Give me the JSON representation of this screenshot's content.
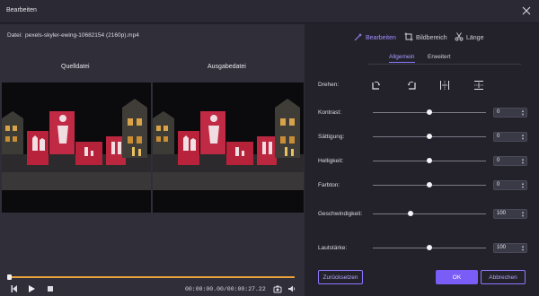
{
  "window": {
    "title": "Bearbeiten"
  },
  "file": {
    "label": "Datei:",
    "name": "pexels-skyler-ewing-10682154 (2160p).mp4"
  },
  "panes": {
    "source_label": "Quelldatei",
    "output_label": "Ausgabedatei"
  },
  "playback": {
    "timecode": "00:00:00.00/00:00:27.22",
    "progress_fraction": 1.0
  },
  "tabs": [
    {
      "label": "Bearbeiten",
      "icon": "magic-wand-icon",
      "active": true
    },
    {
      "label": "Bildbereich",
      "icon": "crop-icon",
      "active": false
    },
    {
      "label": "Länge",
      "icon": "scissors-icon",
      "active": false
    }
  ],
  "subtabs": [
    {
      "label": "Allgemein",
      "active": true
    },
    {
      "label": "Erweitert",
      "active": false
    }
  ],
  "rotate": {
    "label": "Drehen:",
    "buttons": [
      "rotate-right-icon",
      "rotate-left-icon",
      "flip-horizontal-icon",
      "flip-vertical-icon"
    ]
  },
  "adjustments": [
    {
      "label": "Kontrast:",
      "value": "0",
      "slider_fraction": 0.5
    },
    {
      "label": "Sättigung:",
      "value": "0",
      "slider_fraction": 0.5
    },
    {
      "label": "Helligkeit:",
      "value": "0",
      "slider_fraction": 0.5
    },
    {
      "label": "Farbton:",
      "value": "0",
      "slider_fraction": 0.5
    },
    {
      "label": "Geschwindigkeit:",
      "value": "100",
      "slider_fraction": 0.33
    },
    {
      "label": "Lautstärke:",
      "value": "100",
      "slider_fraction": 0.5
    }
  ],
  "buttons": {
    "reset": "Zurücksetzen",
    "ok": "OK",
    "cancel": "Abbrechen"
  },
  "colors": {
    "accent": "#7a5cf6",
    "progress": "#e8a33a",
    "background": "#23222b"
  }
}
